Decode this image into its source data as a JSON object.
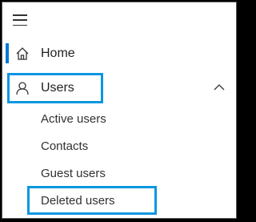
{
  "nav": {
    "menu_icon": "hamburger-icon",
    "items": [
      {
        "label": "Home",
        "icon": "home-icon",
        "active": true
      },
      {
        "label": "Users",
        "icon": "person-icon",
        "expanded": true,
        "chevron": "chevron-up-icon"
      }
    ],
    "users_submenu": [
      {
        "label": "Active users"
      },
      {
        "label": "Contacts"
      },
      {
        "label": "Guest users"
      },
      {
        "label": "Deleted users",
        "highlighted": true
      }
    ]
  },
  "colors": {
    "accent": "#0078d4",
    "highlight": "#0b96e0",
    "frame_background": "#000000"
  }
}
